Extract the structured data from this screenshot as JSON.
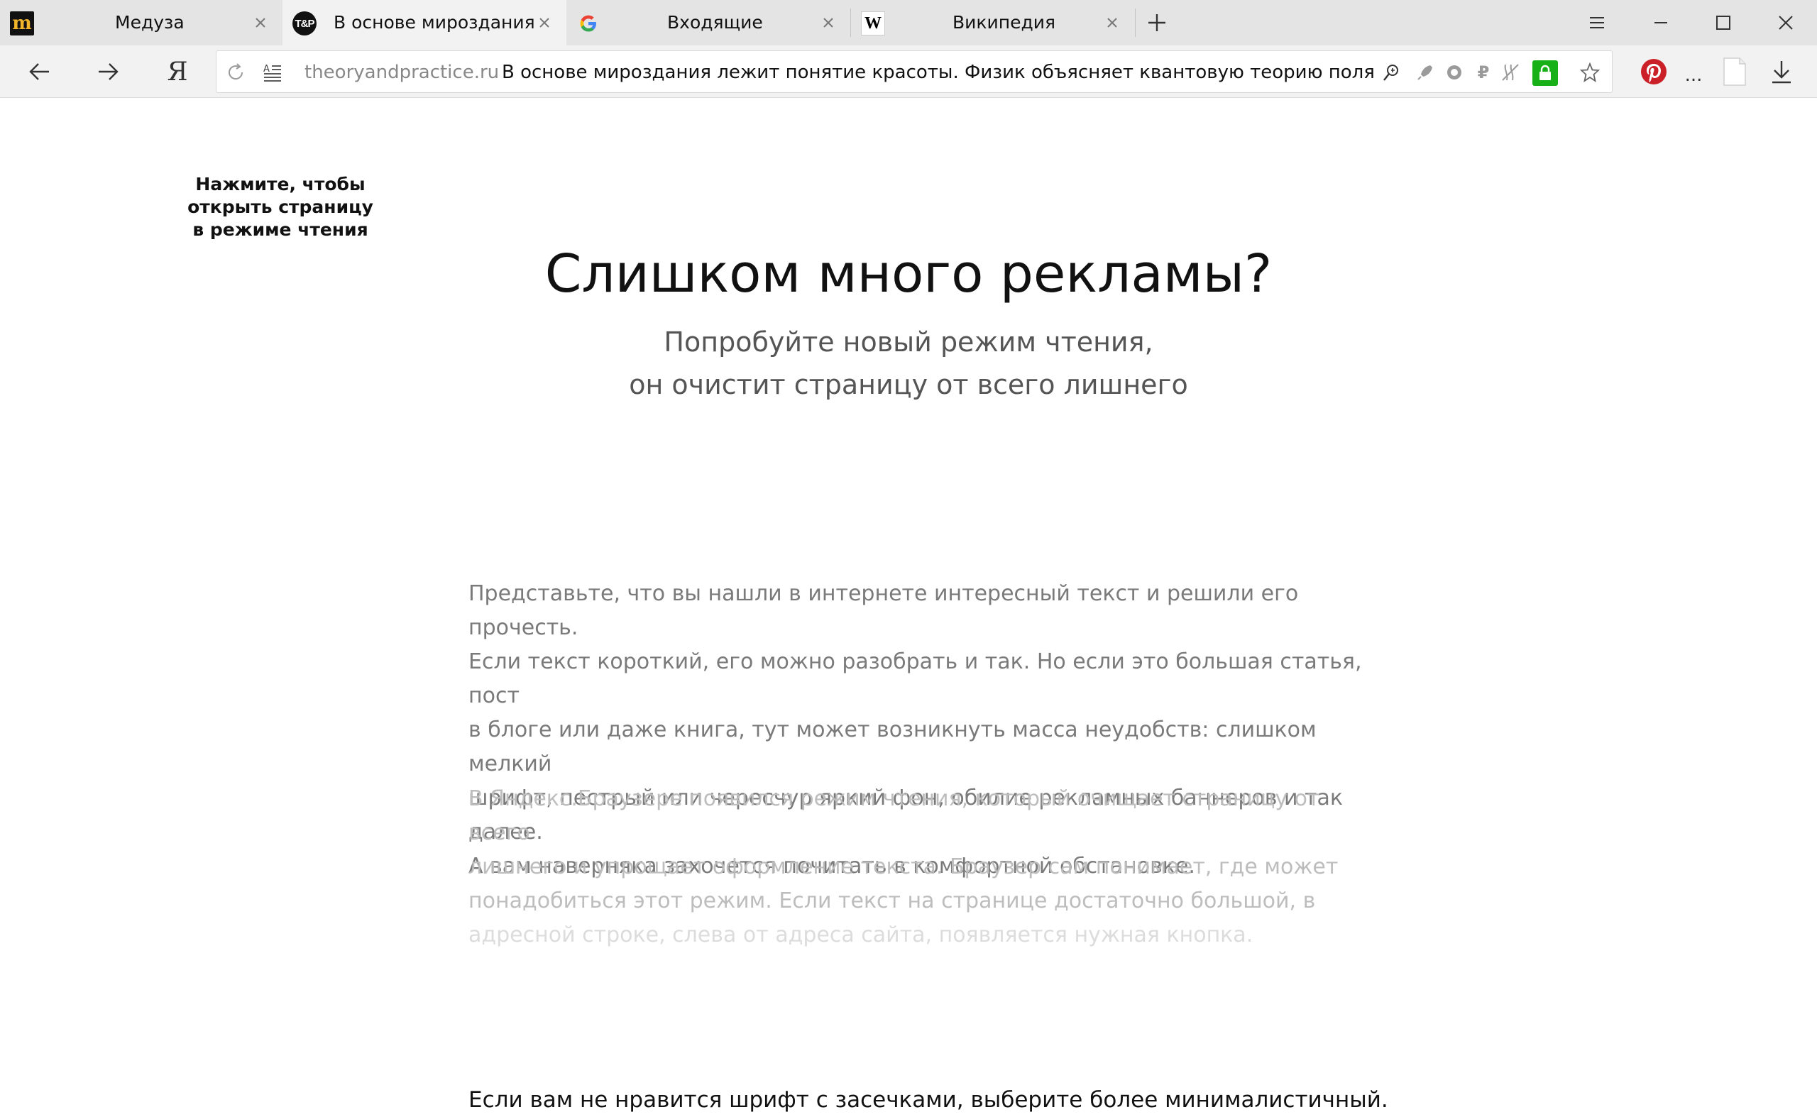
{
  "tabs": [
    {
      "title": "Медуза",
      "favicon": "meduza-logo"
    },
    {
      "title": "В основе мироздания",
      "favicon": "tp-logo",
      "favicon_text": "T&P"
    },
    {
      "title": "Входящие",
      "favicon": "google-logo"
    },
    {
      "title": "Википедия",
      "favicon": "wikipedia-logo",
      "favicon_text": "W"
    }
  ],
  "active_tab_index": 1,
  "toolbar": {
    "yandex_label": "Я",
    "domain": "theoryandpractice.ru",
    "page_title": "В основе мироздания лежит понятие красоты. Физик объясняет квантовую теорию поля",
    "accent_lock": "#17b017",
    "rub_symbol": "₽",
    "more_label": "..."
  },
  "content": {
    "side_hint": [
      "Нажмите, чтобы",
      "открыть страницу",
      "в режиме чтения"
    ],
    "headline": "Слишком много рекламы?",
    "subline": [
      "Попробуйте новый режим чтения,",
      "он очистит страницу от всего лишнего"
    ],
    "paragraph1": [
      "Представьте, что вы нашли в интернете интересный текст и решили его прочесть.",
      "Если текст короткий, его можно разобрать и так. Но если это большая статья, пост",
      "в блоге или даже книга, тут может возникнуть масса неудобств: слишком мелкий",
      "шрифт, пестрый или чересчур яркий фон, обилие рекламных баннеров и так далее.",
      "А вам наверняка захочется почитать в комфортной обстановке."
    ],
    "paragraph2": [
      "В Яндекс.Браузере появился режим чтения, который очищает страницу от всего",
      "лишнего и упрощает оформление текста. Браузер сам понимает, где может",
      "понадобиться этот режим. Если текст на странице достаточно большой, в",
      "адресной строке, слева от адреса сайта, появляется нужная кнопка."
    ],
    "bottom_line": "Если вам не нравится шрифт с засечками, выберите более минималистичный."
  }
}
